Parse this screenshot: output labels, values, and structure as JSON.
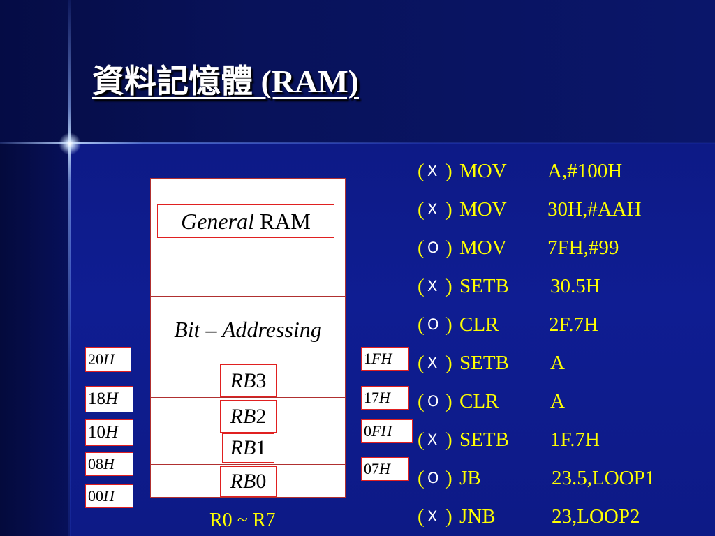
{
  "title": "資料記憶體 (RAM)",
  "ram_map": {
    "general_label": {
      "italic": "General",
      "plain": " RAM"
    },
    "bit_label": "Bit – Addressing",
    "banks": [
      {
        "name": "RB",
        "num": "3"
      },
      {
        "name": "RB",
        "num": "2"
      },
      {
        "name": "RB",
        "num": "1"
      },
      {
        "name": "RB",
        "num": "0"
      }
    ],
    "left_addresses": [
      {
        "num": "20",
        "unit": "H"
      },
      {
        "num": "18",
        "unit": "H"
      },
      {
        "num": "10",
        "unit": "H"
      },
      {
        "num": "08",
        "unit": "H"
      },
      {
        "num": "00",
        "unit": "H"
      }
    ],
    "right_addresses": [
      {
        "num": "1",
        "unit": "FH"
      },
      {
        "num": "17",
        "unit": "H"
      },
      {
        "num": "0",
        "unit": "FH"
      },
      {
        "num": "07",
        "unit": "H"
      }
    ],
    "register_caption": "R0 ~ R7"
  },
  "instructions": [
    {
      "open": "(",
      "mark": "X",
      "close": ")",
      "op": "MOV",
      "arg": "A,#100H"
    },
    {
      "open": "(",
      "mark": "X",
      "close": ")",
      "op": "MOV",
      "arg": "30H,#AAH"
    },
    {
      "open": "(",
      "mark": "O",
      "close": ")",
      "op": "MOV",
      "arg": "7FH,#99"
    },
    {
      "open": "(",
      "mark": "X",
      "close": ")",
      "op": "SETB",
      "arg": "30.5H"
    },
    {
      "open": "(",
      "mark": "O",
      "close": ")",
      "op": "CLR",
      "arg": "2F.7H"
    },
    {
      "open": "(",
      "mark": "X",
      "close": ")",
      "op": "SETB",
      "arg": "A"
    },
    {
      "open": "(",
      "mark": "O",
      "close": ")",
      "op": "CLR",
      "arg": "A"
    },
    {
      "open": "(",
      "mark": "X",
      "close": ")",
      "op": "SETB",
      "arg": "1F.7H"
    },
    {
      "open": "(",
      "mark": "O",
      "close": ")",
      "op": "JB",
      "arg": "23.5,LOOP1"
    },
    {
      "open": "(",
      "mark": "X",
      "close": ")",
      "op": "JNB",
      "arg": "23,LOOP2"
    }
  ],
  "colors": {
    "background": "#0f1d92",
    "title": "#ffffff",
    "text": "#ffff00",
    "marks": "#ffffff",
    "border": "#e02020"
  }
}
